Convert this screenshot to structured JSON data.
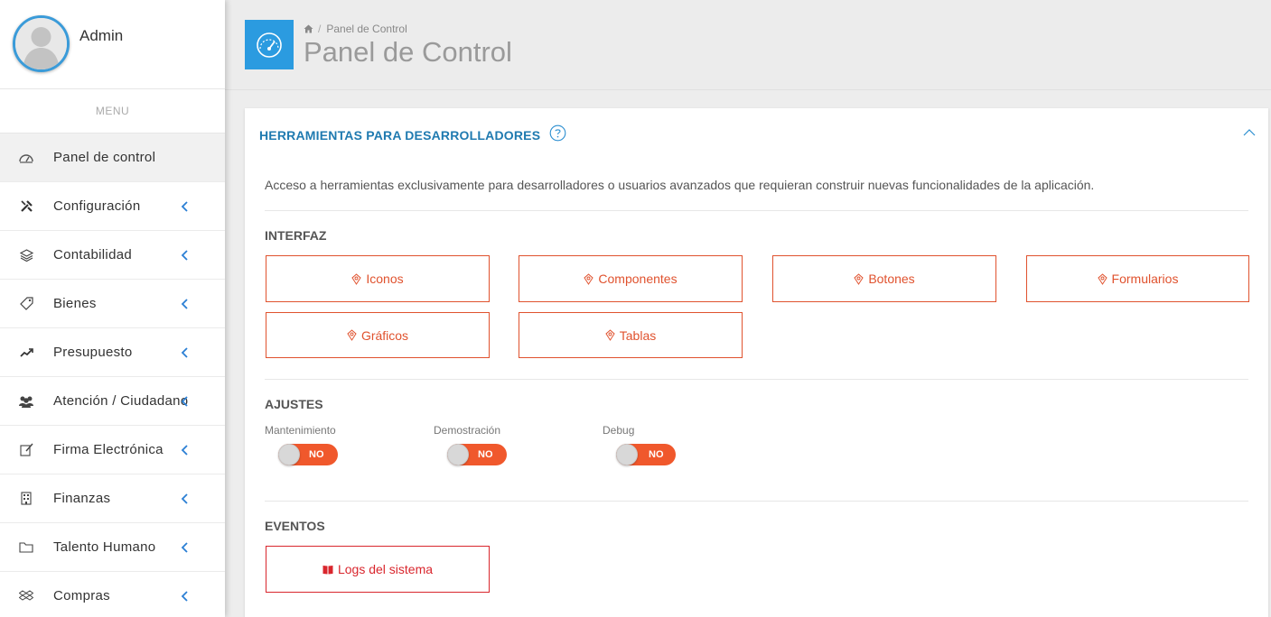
{
  "user": {
    "name": "Admin"
  },
  "sidebar": {
    "menu_title": "MENU",
    "items": [
      {
        "label": "Panel de control",
        "icon": "dashboard-icon",
        "active": true,
        "has_submenu": false
      },
      {
        "label": "Configuración",
        "icon": "tools-icon",
        "has_submenu": true
      },
      {
        "label": "Contabilidad",
        "icon": "layers-icon",
        "has_submenu": true
      },
      {
        "label": "Bienes",
        "icon": "tag-icon",
        "has_submenu": true
      },
      {
        "label": "Presupuesto",
        "icon": "trending-up-icon",
        "has_submenu": true
      },
      {
        "label": "Atención / Ciudadano",
        "icon": "users-icon",
        "has_submenu": true
      },
      {
        "label": "Firma Electrónica",
        "icon": "signature-icon",
        "has_submenu": true
      },
      {
        "label": "Finanzas",
        "icon": "building-icon",
        "has_submenu": true
      },
      {
        "label": "Talento Humano",
        "icon": "folder-icon",
        "has_submenu": true
      },
      {
        "label": "Compras",
        "icon": "dropbox-icon",
        "has_submenu": true
      }
    ]
  },
  "header": {
    "breadcrumb": "Panel de Control",
    "title": "Panel de Control",
    "icon": "speedometer-icon"
  },
  "panel": {
    "title": "HERRAMIENTAS PARA DESARROLLADORES",
    "description": "Acceso a herramientas exclusivamente para desarrolladores o usuarios avanzados que requieran construir nuevas funcionalidades de la aplicación.",
    "interfaz": {
      "title": "INTERFAZ",
      "buttons": [
        "Iconos",
        "Componentes",
        "Botones",
        "Formularios",
        "Gráficos",
        "Tablas"
      ]
    },
    "ajustes": {
      "title": "AJUSTES",
      "toggles": [
        {
          "label": "Mantenimiento",
          "state": "NO"
        },
        {
          "label": "Demostración",
          "state": "NO"
        },
        {
          "label": "Debug",
          "state": "NO"
        }
      ]
    },
    "eventos": {
      "title": "EVENTOS",
      "logs_button": "Logs del sistema"
    }
  },
  "colors": {
    "accent_blue": "#2b9be0",
    "button_orange": "#e0522e",
    "logs_red": "#d9262d",
    "toggle_off": "#f0582c"
  }
}
